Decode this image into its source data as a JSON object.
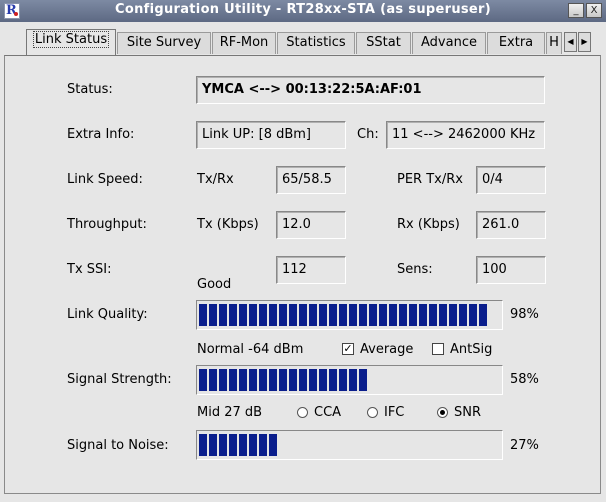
{
  "window": {
    "title": "Configuration Utility - RT28xx-STA (as superuser)",
    "minimize_glyph": "_",
    "close_glyph": "X"
  },
  "tabs": [
    {
      "label": "Link Status",
      "active": true
    },
    {
      "label": "Site Survey"
    },
    {
      "label": "RF-Mon"
    },
    {
      "label": "Statistics"
    },
    {
      "label": "SStat"
    },
    {
      "label": "Advance"
    },
    {
      "label": "Extra"
    },
    {
      "label": "H"
    }
  ],
  "status": {
    "label": "Status:",
    "value": "YMCA <--> 00:13:22:5A:AF:01"
  },
  "extra_info": {
    "label": "Extra Info:",
    "value": "Link UP: [8 dBm]",
    "ch_label": "Ch:",
    "ch_value": "11 <--> 2462000 KHz"
  },
  "link_speed": {
    "label": "Link Speed:",
    "sub_label": "Tx/Rx",
    "value": "65/58.5",
    "per_label": "PER Tx/Rx",
    "per_value": "0/4"
  },
  "throughput": {
    "label": "Throughput:",
    "tx_label": "Tx (Kbps)",
    "tx_value": "12.0",
    "rx_label": "Rx (Kbps)",
    "rx_value": "261.0"
  },
  "tx_ssi": {
    "label": "Tx SSI:",
    "value": "112",
    "sens_label": "Sens:",
    "sens_value": "100"
  },
  "link_quality": {
    "caption": "Good",
    "label": "Link Quality:",
    "percent": 98,
    "percent_text": "98%"
  },
  "signal_strength": {
    "caption": "Normal -64 dBm",
    "label": "Signal Strength:",
    "percent": 58,
    "percent_text": "58%",
    "average_label": "Average",
    "average_checked": true,
    "antsig_label": "AntSig",
    "antsig_checked": false
  },
  "signal_noise": {
    "caption": "Mid 27 dB",
    "label": "Signal to Noise:",
    "percent": 27,
    "percent_text": "27%",
    "radios": [
      {
        "label": "CCA",
        "selected": false
      },
      {
        "label": "IFC",
        "selected": false
      },
      {
        "label": "SNR",
        "selected": true
      }
    ]
  },
  "colors": {
    "titlebar": "#6c7893",
    "bar_fill": "#0a1e8c",
    "background": "#e6e6e6"
  }
}
